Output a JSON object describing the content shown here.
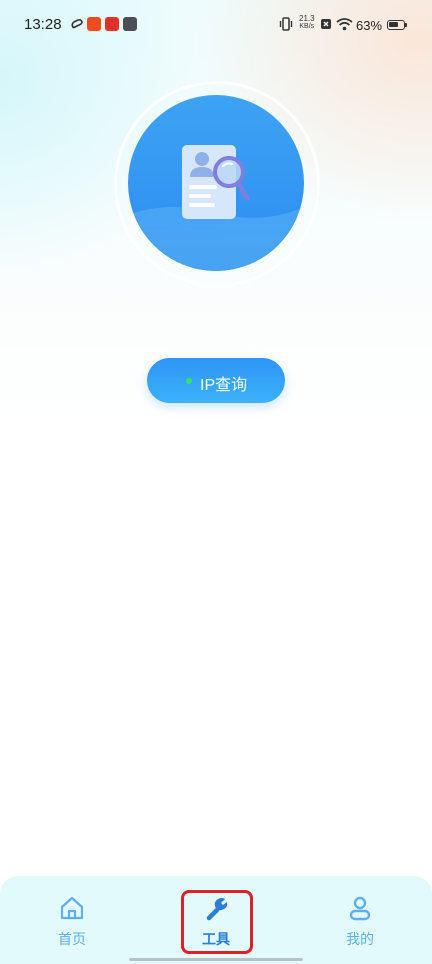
{
  "status_bar": {
    "time": "13:28",
    "net_speed_value": "21.3",
    "net_speed_unit": "KB/s",
    "battery_percent": "63%"
  },
  "feature": {
    "button_label": "IP查询",
    "status_dot_color": "#33e06a",
    "accent_color": "#2d95f5"
  },
  "tab_bar": {
    "tabs": [
      {
        "label": "首页",
        "icon": "home-icon",
        "active": false
      },
      {
        "label": "工具",
        "icon": "wrench-icon",
        "active": true
      },
      {
        "label": "我的",
        "icon": "person-icon",
        "active": false
      }
    ],
    "active_color": "#2b7fd6",
    "inactive_color": "#5fb0e8",
    "highlight_color": "#d9222a"
  }
}
